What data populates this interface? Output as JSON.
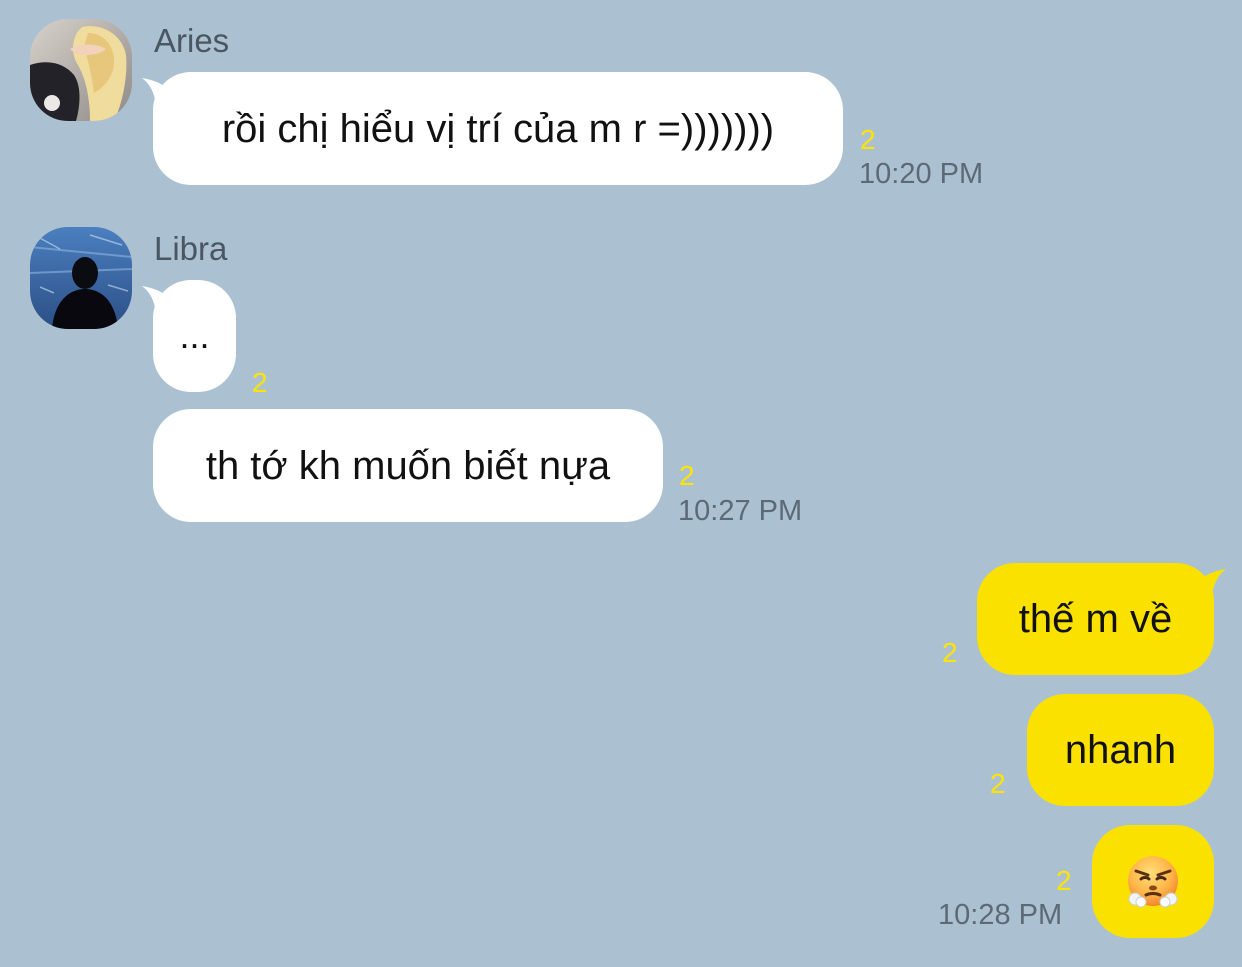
{
  "colors": {
    "background": "#abc1d2",
    "incoming_bubble": "#ffffff",
    "outgoing_bubble": "#fae100",
    "unread_count": "#ffe400",
    "timestamp": "#5d6a76"
  },
  "messages": [
    {
      "sender": "Aries",
      "avatar": "avatar-aries",
      "text": "rồi chị hiểu vị trí của m r =)))))))",
      "unread": "2",
      "time": "10:20 PM"
    },
    {
      "sender": "Libra",
      "avatar": "avatar-libra",
      "text": "...",
      "unread": "2",
      "time": ""
    },
    {
      "sender": "Libra",
      "text": "th tớ kh muốn biết nựa",
      "unread": "2",
      "time": "10:27 PM"
    },
    {
      "sender": "me",
      "text": "thế m về",
      "unread": "2",
      "time": ""
    },
    {
      "sender": "me",
      "text": "nhanh",
      "unread": "2",
      "time": ""
    },
    {
      "sender": "me",
      "text": "",
      "emoji": "face-with-steam-from-nose",
      "unread": "2",
      "time": "10:28 PM"
    }
  ]
}
